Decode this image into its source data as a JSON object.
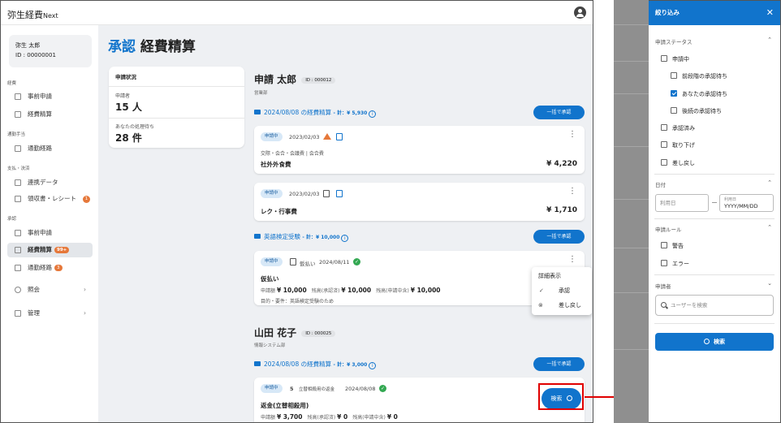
{
  "app": {
    "title": "弥生経費",
    "title_suffix": "Next"
  },
  "user": {
    "name": "弥生 太郎",
    "id": "ID : 00000001"
  },
  "sidebar": {
    "sec_expense": "経費",
    "item_preapp": "事前申請",
    "item_settle": "経費精算",
    "sec_commute": "通勤手当",
    "item_route": "通勤経路",
    "sec_payment": "支払・決済",
    "item_link": "連携データ",
    "item_receipt": "領収書・レシート",
    "receipt_badge": "1",
    "sec_approval": "承認",
    "item_ap_pre": "事前申請",
    "item_ap_settle": "経費精算",
    "ap_settle_badge": "99+",
    "item_ap_route": "通勤経路",
    "ap_route_badge": "3",
    "item_query": "照会",
    "item_admin": "管理"
  },
  "page": {
    "title_prefix": "承認",
    "title": "経費精算"
  },
  "status_card": {
    "heading": "申請状況",
    "applicants_label": "申請者",
    "applicants_value": "15 人",
    "pending_label": "あなたの処理待ち",
    "pending_value": "28 件"
  },
  "group1": {
    "person": "申請 太郎",
    "id": "ID : 000012",
    "dept": "営業部",
    "g1_title": "2024/08/08 の経費精算",
    "g1_total": "- 計：¥ 5,930",
    "bulk": "一括で承認",
    "c1": {
      "status": "申請中",
      "date": "2023/02/03",
      "sub": "交際・会合・会議費 | 会合費",
      "name": "社外外食費",
      "amount": "¥ 4,220"
    },
    "c2": {
      "status": "申請中",
      "date": "2023/02/03",
      "name": "レク・行事費",
      "amount": "¥ 1,710"
    },
    "g2_title": "英語検定受験",
    "g2_total": "- 計：¥ 10,000",
    "c3": {
      "status": "申請中",
      "kind": "仮払い",
      "date": "2024/08/11",
      "name": "仮払い",
      "l1": "申請額",
      "v1": "¥ 10,000",
      "l2": "残高(承認済)",
      "v2": "¥ 10,000",
      "l3": "残高(申請中含)",
      "v3": "¥ 10,000",
      "purpose": "目的・要件：英語検定受験のため"
    }
  },
  "context_menu": {
    "title": "詳細表示",
    "approve": "承認",
    "reject": "差し戻し"
  },
  "group2": {
    "person": "山田 花子",
    "id": "ID : 000025",
    "dept": "情報システム部",
    "g_title": "2024/08/08 の経費精算",
    "g_total": "- 計：¥ 3,000",
    "bulk": "一括で承認",
    "c1": {
      "status": "申請中",
      "kind": "立替相殺用の返金",
      "date": "2024/08/08",
      "name": "返金(立替相殺用)",
      "l1": "申請額",
      "v1": "¥ 3,700",
      "l2": "残高(承認済)",
      "v2": "¥ 0",
      "l3": "残高(申請中含)",
      "v3": "¥ 0"
    }
  },
  "fab": {
    "label": "検索"
  },
  "filter": {
    "title": "絞り込み",
    "status_heading": "申請ステータス",
    "st_pending": "申請中",
    "st_prev": "前段階の承認待ち",
    "st_mine": "あなたの承認待ち",
    "st_next": "後続の承認待ち",
    "st_approved": "承認済み",
    "st_withdrawn": "取り下げ",
    "st_returned": "差し戻し",
    "date_heading": "日付",
    "date_from_placeholder": "利用日",
    "date_to_label": "利用日",
    "date_to_placeholder": "YYYY/MM/DD",
    "rule_heading": "申請ルール",
    "rule_warn": "警告",
    "rule_error": "エラー",
    "applicant_heading": "申請者",
    "applicant_placeholder": "ユーザーを検索",
    "search_button": "検索"
  },
  "colors": {
    "accent": "#1174cc",
    "badge": "#e6783a",
    "highlight": "#e00000"
  }
}
